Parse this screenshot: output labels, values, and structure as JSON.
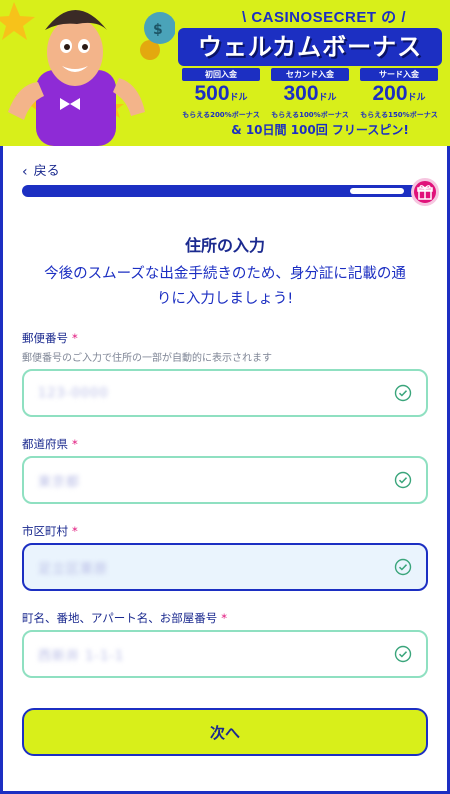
{
  "banner": {
    "brand": "\\ CASINOSECRET の /",
    "headline": "ウェルカムボーナス",
    "bonuses": [
      {
        "tag": "初回入金",
        "amount": "500",
        "unit": "ドル",
        "desc": "もらえる200%ボーナス"
      },
      {
        "tag": "セカンド入金",
        "amount": "300",
        "unit": "ドル",
        "desc": "もらえる100%ボーナス"
      },
      {
        "tag": "サード入金",
        "amount": "200",
        "unit": "ドル",
        "desc": "もらえる150%ボーナス"
      }
    ],
    "freespin": "& 10日間 100回 フリースピン!"
  },
  "nav": {
    "back_label": "戻る"
  },
  "progress": {
    "fraction": 0.9
  },
  "form": {
    "title": "住所の入力",
    "subtitle": "今後のスムーズな出金手続きのため、身分証に記載の通りに入力しましょう!",
    "required_mark": "*",
    "postal": {
      "label": "郵便番号",
      "hint": "郵便番号のご入力で住所の一部が自動的に表示されます",
      "value": "123-0000"
    },
    "prefecture": {
      "label": "都道府県",
      "value": "東京都"
    },
    "city": {
      "label": "市区町村",
      "value": "足立区栗原"
    },
    "address": {
      "label": "町名、番地、アパート名、お部屋番号",
      "value": "西新井 1-1-1"
    }
  },
  "actions": {
    "next_label": "次へ"
  },
  "colors": {
    "accent": "#1c2fc2",
    "lime": "#d8ef1a",
    "valid": "#8fe0c1",
    "pink": "#e0127a"
  }
}
